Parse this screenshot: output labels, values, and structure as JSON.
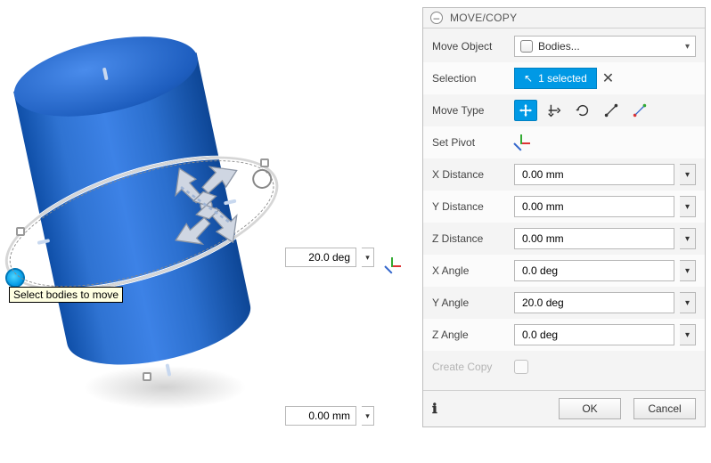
{
  "panel": {
    "title": "MOVE/COPY",
    "rows": {
      "move_object": {
        "label": "Move Object",
        "value": "Bodies..."
      },
      "selection": {
        "label": "Selection",
        "chip": "1 selected"
      },
      "move_type": {
        "label": "Move Type"
      },
      "set_pivot": {
        "label": "Set Pivot"
      },
      "x_distance": {
        "label": "X Distance",
        "value": "0.00 mm"
      },
      "y_distance": {
        "label": "Y Distance",
        "value": "0.00 mm"
      },
      "z_distance": {
        "label": "Z Distance",
        "value": "0.00 mm"
      },
      "x_angle": {
        "label": "X Angle",
        "value": "0.0 deg"
      },
      "y_angle": {
        "label": "Y Angle",
        "value": "20.0 deg"
      },
      "z_angle": {
        "label": "Z Angle",
        "value": "0.0 deg"
      },
      "create_copy": {
        "label": "Create Copy"
      }
    },
    "buttons": {
      "ok": "OK",
      "cancel": "Cancel"
    }
  },
  "viewport": {
    "tooltip": "Select bodies to move",
    "float_angle": "20.0 deg",
    "float_dist": "0.00 mm"
  },
  "icons": {
    "cursor": "▸",
    "chevron_down": "▾"
  }
}
